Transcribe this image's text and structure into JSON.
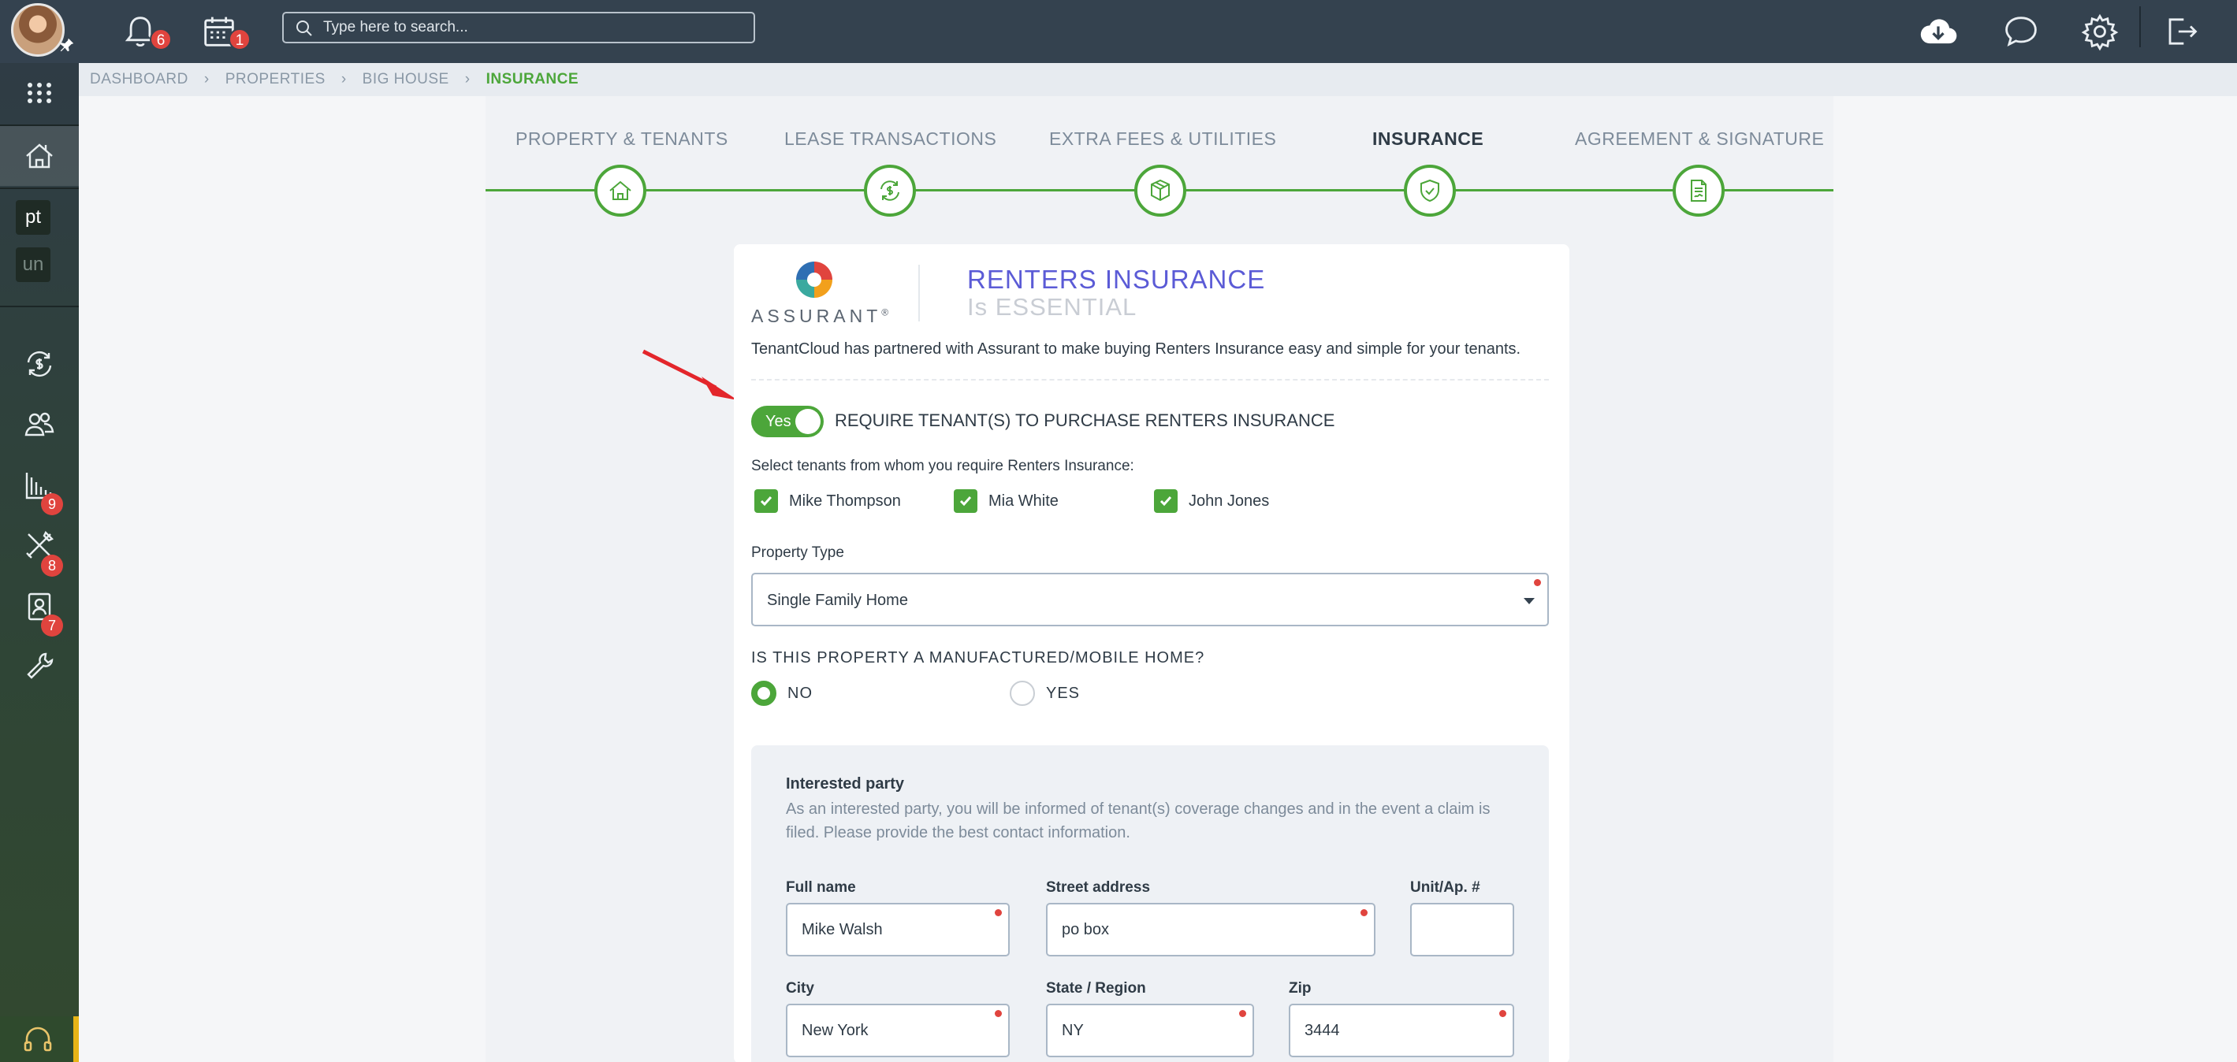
{
  "topbar": {
    "notifications_count": "6",
    "calendar_count": "1",
    "search_placeholder": "Type here to search..."
  },
  "sidebar": {
    "tag_pt": "pt",
    "tag_un": "un",
    "badges": {
      "maintenance": "9",
      "contacts": "8",
      "tools": "7"
    }
  },
  "breadcrumb": [
    "DASHBOARD",
    "PROPERTIES",
    "BIG HOUSE",
    "INSURANCE"
  ],
  "wizard": {
    "steps": [
      {
        "label": "PROPERTY & TENANTS",
        "icon": "house-icon"
      },
      {
        "label": "LEASE TRANSACTIONS",
        "icon": "money-cycle-icon"
      },
      {
        "label": "EXTRA FEES & UTILITIES",
        "icon": "box-icon"
      },
      {
        "label": "INSURANCE",
        "icon": "shield-icon",
        "active": true
      },
      {
        "label": "AGREEMENT & SIGNATURE",
        "icon": "document-icon"
      }
    ]
  },
  "insurance": {
    "logo_text": "ASSURANT",
    "logo_mark": "®",
    "title": "RENTERS INSURANCE",
    "subtitle": "Is ESSENTIAL",
    "partner_text": "TenantCloud has partnered with Assurant to make buying Renters Insurance easy and simple for your tenants.",
    "toggle_label": "Yes",
    "toggle_on": true,
    "require_text": "REQUIRE TENANT(S) TO PURCHASE RENTERS INSURANCE",
    "select_tenants_label": "Select tenants from whom you require Renters Insurance:",
    "tenants": [
      {
        "name": "Mike Thompson",
        "checked": true
      },
      {
        "name": "Mia White",
        "checked": true
      },
      {
        "name": "John Jones",
        "checked": true
      }
    ],
    "property_type_label": "Property Type",
    "property_type_value": "Single Family Home",
    "mobile_question": "IS THIS PROPERTY A MANUFACTURED/MOBILE HOME?",
    "mobile_options": [
      {
        "label": "NO",
        "selected": true
      },
      {
        "label": "YES",
        "selected": false
      }
    ]
  },
  "interested_party": {
    "title": "Interested party",
    "description": "As an interested party, you will be informed of tenant(s) coverage changes and in the event a claim is filed. Please provide the best contact information.",
    "full_name_label": "Full name",
    "full_name_value": "Mike Walsh",
    "street_label": "Street address",
    "street_value": "po box",
    "unit_label": "Unit/Ap. #",
    "unit_value": "",
    "city_label": "City",
    "city_value": "New York",
    "state_label": "State / Region",
    "state_value": "NY",
    "zip_label": "Zip",
    "zip_value": "3444"
  },
  "colors": {
    "topbar": "#34424f",
    "accent_green": "#4ca63a",
    "badge_red": "#e0443e",
    "title_purple": "#5b5bd6",
    "arrow_red": "#e3262b"
  }
}
